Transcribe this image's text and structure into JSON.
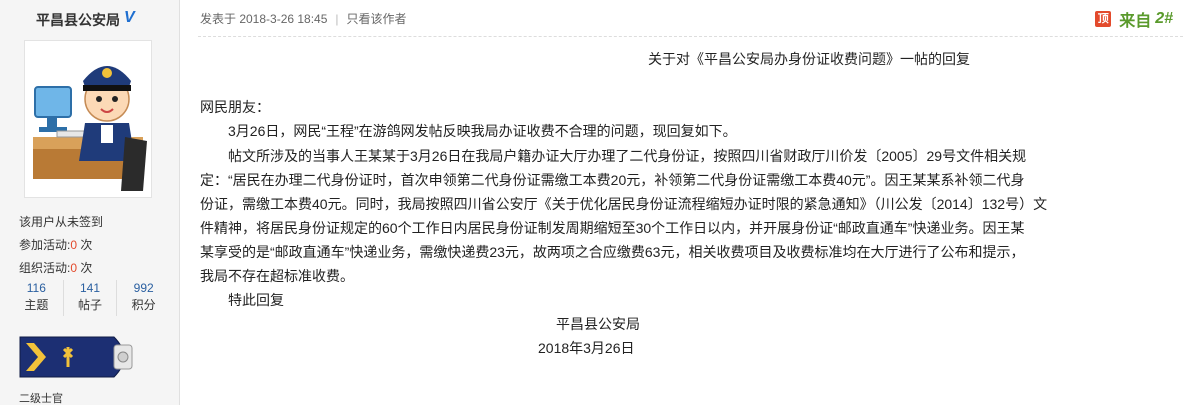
{
  "user": {
    "name": "平昌县公安局",
    "verified_badge": "V",
    "sign_status": "该用户从未签到",
    "activities": [
      {
        "label": "参加活动:",
        "value": "0",
        "unit": " 次"
      },
      {
        "label": "组织活动:",
        "value": "0",
        "unit": " 次"
      }
    ],
    "stats": [
      {
        "value": "116",
        "label": "主题"
      },
      {
        "value": "141",
        "label": "帖子"
      },
      {
        "value": "992",
        "label": "积分"
      }
    ],
    "rank": "二级士官"
  },
  "post": {
    "posted_prefix": "发表于 2018-3-26 18:45",
    "author_only": "只看该作者",
    "floor_top_icon": "顶",
    "floor_source": "来自",
    "floor_number": "2#",
    "reply_title": "关于对《平昌公安局办身份证收费问题》一帖的回复",
    "lines": [
      "网民朋友：",
      "　　3月26日，网民“王程”在游鸽网发帖反映我局办证收费不合理的问题，现回复如下。",
      "　　帖文所涉及的当事人王某某于3月26日在我局户籍办证大厅办理了二代身份证，按照四川省财政厅川价发〔2005〕29号文件相关规",
      "定：“居民在办理二代身份证时，首次申领第二代身份证需缴工本费20元，补领第二代身份证需缴工本费40元”。因王某某系补领二代身",
      "份证，需缴工本费40元。同时，我局按照四川省公安厅《关于优化居民身份证流程缩短办证时限的紧急通知》（川公发〔2014〕132号）文",
      "件精神，将居民身份证规定的60个工作日内居民身份证制发周期缩短至30个工作日以内，并开展身份证“邮政直通车”快递业务。因王某",
      "某享受的是“邮政直通车”快递业务，需缴快递费23元，故两项之合应缴费63元，相关收费项目及收费标准均在大厅进行了公布和提示，",
      "我局不存在超标准收费。",
      "　　特此回复"
    ],
    "signature": "平昌县公安局",
    "date": "2018年3月26日"
  },
  "colors": {
    "accent_blue": "#2a5fa0",
    "highlight_red": "#e34a2c",
    "floor_green": "#5a9a2c"
  }
}
